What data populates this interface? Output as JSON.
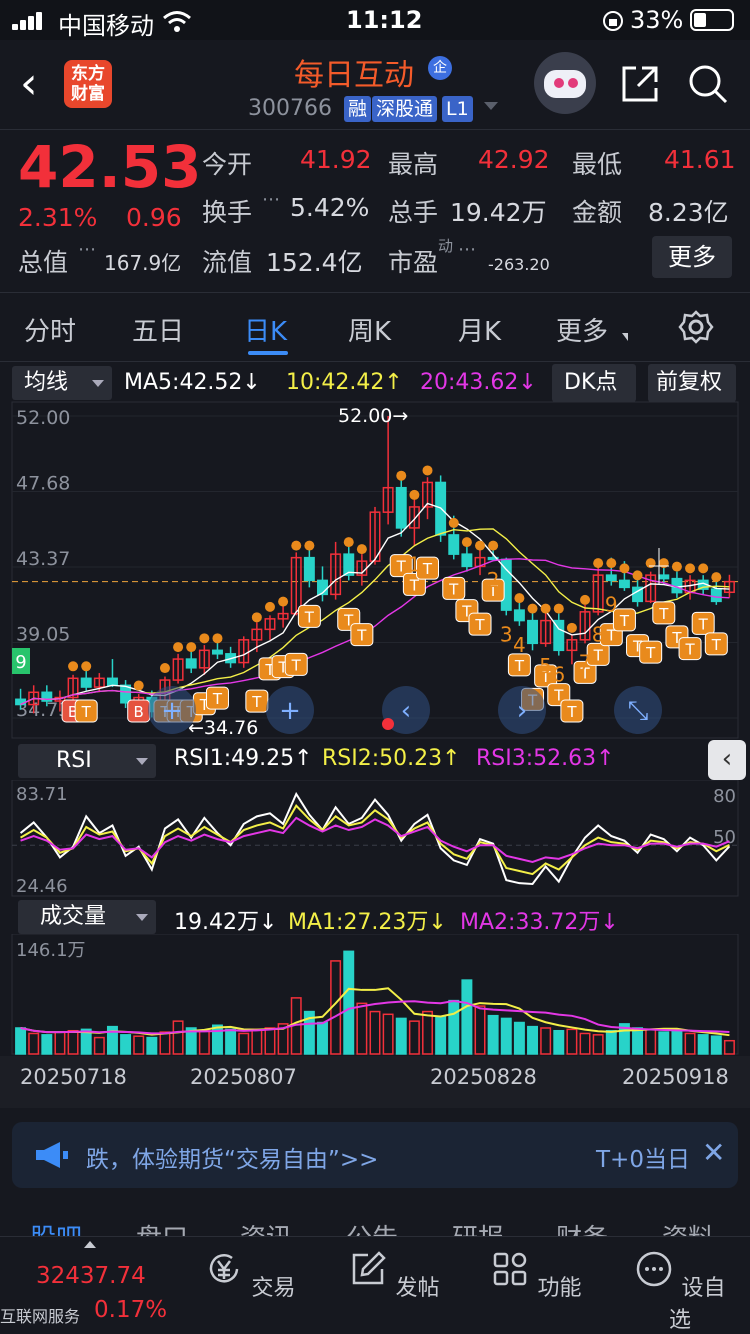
{
  "status": {
    "carrier": "中国移动",
    "time": "11:12",
    "battery": "33%"
  },
  "header": {
    "logo": "东方财富",
    "title": "每日互动",
    "badge": "企",
    "code": "300766",
    "tags": [
      "融",
      "深股通",
      "L1"
    ]
  },
  "quote": {
    "price": "42.53",
    "change_pct": "2.31%",
    "change": "0.96",
    "open_label": "今开",
    "open": "41.92",
    "high_label": "最高",
    "high": "42.92",
    "low_label": "最低",
    "low": "41.61",
    "turnover_label": "换手",
    "turnover": "5.42%",
    "volume_label": "总手",
    "volume": "19.42万",
    "amount_label": "金额",
    "amount": "8.23亿",
    "mktcap_label": "总值",
    "mktcap": "167.9亿",
    "float_label": "流值",
    "float": "152.4亿",
    "pe_label": "市盈",
    "pe_sup": "动",
    "pe": "-263.20",
    "more": "更多"
  },
  "tabs": [
    "分时",
    "五日",
    "日K",
    "周K",
    "月K",
    "更多"
  ],
  "active_tab": "日K",
  "ma_bar": {
    "selector": "均线",
    "ma5": "MA5:42.52↓",
    "ma10": "10:42.42↑",
    "ma20": "20:43.62↓",
    "dk": "DK点",
    "fq": "前复权"
  },
  "rsi_bar": {
    "selector": "RSI",
    "rsi1": "RSI1:49.25↑",
    "rsi2": "RSI2:50.23↑",
    "rsi3": "RSI3:52.63↑"
  },
  "vol_bar": {
    "selector": "成交量",
    "vol": "19.42万↓",
    "ma1": "MA1:27.23万↓",
    "ma2": "MA2:33.72万↓"
  },
  "colors": {
    "up": "#f2303a",
    "down": "#28d3c9",
    "ma5": "#ffffff",
    "ma10": "#f3ef48",
    "ma20": "#e337e6",
    "accent": "#3c8cf7",
    "brand": "#f45b2a"
  },
  "chart_data": [
    {
      "type": "candlestick",
      "yticks": [
        "52.00",
        "47.68",
        "43.37",
        "39.05",
        "34.73"
      ],
      "ylim": [
        34.73,
        52.0
      ],
      "annotations": {
        "max": "52.00→",
        "min": "←34.76",
        "left_number": "9"
      },
      "markers": [
        "B",
        "T",
        "1",
        "2",
        "3",
        "4",
        "5",
        "6",
        "7",
        "8",
        "9"
      ],
      "candles": [
        [
          35.8,
          36.4,
          35.2,
          35.5
        ],
        [
          35.5,
          36.6,
          35.0,
          36.2
        ],
        [
          36.2,
          36.6,
          35.4,
          35.7
        ],
        [
          35.7,
          36.3,
          35.1,
          35.9
        ],
        [
          35.9,
          37.2,
          35.6,
          37.0
        ],
        [
          37.0,
          37.5,
          36.3,
          36.5
        ],
        [
          36.5,
          37.3,
          36.2,
          37.0
        ],
        [
          37.0,
          38.1,
          36.5,
          36.6
        ],
        [
          36.6,
          36.9,
          35.3,
          35.6
        ],
        [
          35.6,
          36.1,
          35.1,
          35.9
        ],
        [
          35.9,
          36.3,
          34.76,
          35.1
        ],
        [
          35.1,
          37.1,
          35.0,
          36.9
        ],
        [
          36.9,
          38.4,
          36.7,
          38.1
        ],
        [
          38.1,
          38.6,
          37.3,
          37.6
        ],
        [
          37.6,
          38.9,
          37.2,
          38.6
        ],
        [
          38.6,
          39.2,
          38.1,
          38.4
        ],
        [
          38.4,
          38.8,
          37.6,
          37.9
        ],
        [
          37.9,
          39.4,
          37.6,
          39.2
        ],
        [
          39.2,
          40.2,
          38.5,
          39.8
        ],
        [
          39.8,
          40.6,
          39.2,
          40.4
        ],
        [
          40.4,
          41.2,
          39.9,
          40.7
        ],
        [
          40.7,
          44.2,
          40.6,
          43.9
        ],
        [
          43.9,
          44.6,
          42.2,
          42.6
        ],
        [
          42.6,
          43.4,
          41.4,
          41.8
        ],
        [
          41.8,
          44.8,
          41.5,
          44.1
        ],
        [
          44.1,
          44.6,
          42.6,
          42.9
        ],
        [
          42.9,
          44.1,
          42.3,
          43.7
        ],
        [
          43.7,
          46.8,
          43.5,
          46.5
        ],
        [
          46.5,
          52.0,
          45.8,
          47.9
        ],
        [
          47.9,
          48.6,
          45.1,
          45.6
        ],
        [
          45.6,
          47.4,
          44.6,
          46.8
        ],
        [
          46.8,
          48.5,
          46.1,
          48.2
        ],
        [
          48.2,
          48.6,
          44.8,
          45.2
        ],
        [
          45.2,
          46.3,
          43.8,
          44.1
        ],
        [
          44.1,
          44.6,
          43.1,
          43.4
        ],
        [
          43.4,
          44.4,
          42.9,
          43.9
        ],
        [
          43.9,
          44.6,
          43.7,
          43.8
        ],
        [
          43.8,
          43.9,
          40.6,
          40.9
        ],
        [
          40.9,
          41.8,
          40.0,
          40.3
        ],
        [
          40.3,
          40.8,
          38.6,
          39.0
        ],
        [
          39.0,
          40.8,
          38.8,
          40.3
        ],
        [
          40.3,
          40.7,
          38.3,
          38.6
        ],
        [
          38.6,
          39.5,
          37.8,
          39.2
        ],
        [
          39.2,
          41.2,
          39.0,
          40.8
        ],
        [
          40.8,
          43.4,
          40.6,
          42.9
        ],
        [
          42.9,
          43.9,
          42.3,
          42.6
        ],
        [
          42.6,
          43.7,
          42.0,
          42.2
        ],
        [
          42.2,
          43.0,
          41.1,
          41.4
        ],
        [
          41.4,
          43.1,
          41.3,
          42.9
        ],
        [
          42.9,
          43.5,
          42.4,
          42.7
        ],
        [
          42.7,
          43.1,
          41.6,
          41.9
        ],
        [
          41.9,
          42.9,
          41.5,
          42.6
        ],
        [
          42.6,
          42.9,
          41.8,
          42.1
        ],
        [
          42.1,
          42.7,
          41.2,
          41.4
        ],
        [
          41.92,
          42.92,
          41.61,
          42.53
        ]
      ]
    },
    {
      "type": "line",
      "name": "RSI",
      "yticks": [
        "83.71",
        "24.46"
      ],
      "right_ticks": [
        "80",
        "50"
      ],
      "series": [
        {
          "name": "RSI1",
          "values": [
            58,
            65,
            55,
            42,
            49,
            69,
            58,
            63,
            43,
            49,
            34,
            61,
            67,
            55,
            68,
            58,
            50,
            64,
            69,
            71,
            64,
            84,
            70,
            60,
            75,
            64,
            68,
            80,
            70,
            53,
            64,
            70,
            48,
            40,
            37,
            54,
            51,
            27,
            25,
            22,
            36,
            26,
            42,
            55,
            63,
            56,
            53,
            45,
            57,
            54,
            46,
            55,
            50,
            40,
            49.25
          ]
        },
        {
          "name": "RSI2",
          "values": [
            55,
            60,
            55,
            45,
            48,
            62,
            57,
            59,
            46,
            48,
            38,
            56,
            61,
            56,
            62,
            57,
            52,
            60,
            63,
            65,
            61,
            76,
            67,
            60,
            69,
            63,
            65,
            73,
            67,
            55,
            61,
            65,
            51,
            44,
            41,
            52,
            50,
            35,
            33,
            31,
            38,
            34,
            42,
            50,
            55,
            52,
            51,
            47,
            53,
            52,
            48,
            52,
            51,
            46,
            50.23
          ]
        },
        {
          "name": "RSI3",
          "values": [
            53,
            56,
            53,
            47,
            48,
            57,
            54,
            56,
            47,
            48,
            42,
            52,
            56,
            53,
            57,
            54,
            52,
            56,
            58,
            60,
            58,
            68,
            63,
            59,
            63,
            60,
            62,
            67,
            63,
            56,
            59,
            62,
            53,
            49,
            46,
            50,
            50,
            43,
            41,
            39,
            42,
            41,
            44,
            48,
            51,
            50,
            50,
            48,
            51,
            51,
            49,
            51,
            51,
            49,
            52.63
          ]
        }
      ]
    },
    {
      "type": "bar",
      "name": "成交量",
      "yticks": [
        "146.1万"
      ],
      "xticks": [
        "20250718",
        "20250807",
        "20250828",
        "20250918"
      ],
      "volumes": [
        38,
        30,
        28,
        32,
        34,
        36,
        24,
        40,
        28,
        26,
        24,
        32,
        48,
        38,
        34,
        42,
        36,
        30,
        36,
        38,
        44,
        82,
        62,
        46,
        136,
        150,
        74,
        62,
        58,
        52,
        48,
        62,
        54,
        78,
        108,
        70,
        56,
        52,
        46,
        40,
        38,
        34,
        36,
        30,
        28,
        34,
        44,
        38,
        36,
        32,
        34,
        30,
        28,
        26,
        19.42
      ]
    }
  ],
  "banner": {
    "text": "跌，体验期货“交易自由”>>",
    "right": "T+0当日",
    "close": "✕"
  },
  "subtabs": [
    "股吧",
    "盘口",
    "资讯",
    "公告",
    "研报",
    "财务",
    "资料"
  ],
  "bottom": {
    "index_value": "32437.74",
    "index_pct": "0.17%",
    "index_name": "互联网服务",
    "nav": [
      "交易",
      "发帖",
      "功能",
      "设自选"
    ]
  }
}
